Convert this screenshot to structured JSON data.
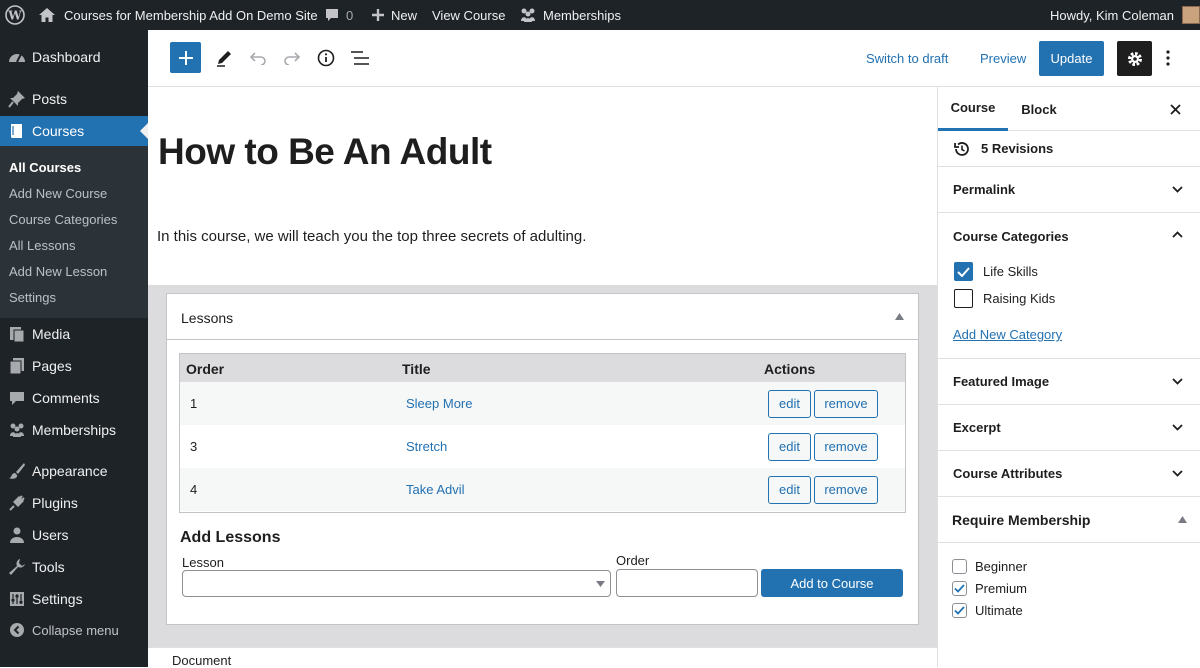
{
  "adminbar": {
    "site_name": "Courses for Membership Add On Demo Site",
    "comments_count": "0",
    "new_label": "New",
    "view_label": "View Course",
    "memberships_label": "Memberships",
    "howdy": "Howdy, Kim Coleman"
  },
  "sidebar": {
    "dashboard": "Dashboard",
    "posts": "Posts",
    "courses": "Courses",
    "sub": [
      "All Courses",
      "Add New Course",
      "Course Categories",
      "All Lessons",
      "Add New Lesson",
      "Settings"
    ],
    "media": "Media",
    "pages": "Pages",
    "comments": "Comments",
    "memberships": "Memberships",
    "appearance": "Appearance",
    "plugins": "Plugins",
    "users": "Users",
    "tools": "Tools",
    "settings": "Settings",
    "collapse": "Collapse menu"
  },
  "toolbar": {
    "switch_draft": "Switch to draft",
    "preview": "Preview",
    "update": "Update"
  },
  "editor": {
    "title": "How to Be An Adult",
    "paragraph": "In this course, we will teach you the top three secrets of adulting."
  },
  "lessons": {
    "box_title": "Lessons",
    "headers": {
      "order": "Order",
      "title": "Title",
      "actions": "Actions"
    },
    "rows": [
      {
        "order": "1",
        "title": "Sleep More"
      },
      {
        "order": "3",
        "title": "Stretch"
      },
      {
        "order": "4",
        "title": "Take Advil"
      }
    ],
    "edit_label": "edit",
    "remove_label": "remove",
    "add_heading": "Add Lessons",
    "lesson_label": "Lesson",
    "order_label": "Order",
    "add_button": "Add to Course"
  },
  "docbar": {
    "label": "Document"
  },
  "panel": {
    "tab_course": "Course",
    "tab_block": "Block",
    "revisions": "5 Revisions",
    "permalink": "Permalink",
    "categories_title": "Course Categories",
    "categories": [
      {
        "label": "Life Skills",
        "checked": true
      },
      {
        "label": "Raising Kids",
        "checked": false
      }
    ],
    "add_category": "Add New Category",
    "featured": "Featured Image",
    "excerpt": "Excerpt",
    "attributes": "Course Attributes",
    "require_title": "Require Membership",
    "levels": [
      {
        "label": "Beginner",
        "checked": false
      },
      {
        "label": "Premium",
        "checked": true
      },
      {
        "label": "Ultimate",
        "checked": true
      }
    ]
  },
  "colors": {
    "accent": "#2271b1",
    "adminbar": "#1d2327",
    "metabox_bg": "#dcdcde"
  }
}
